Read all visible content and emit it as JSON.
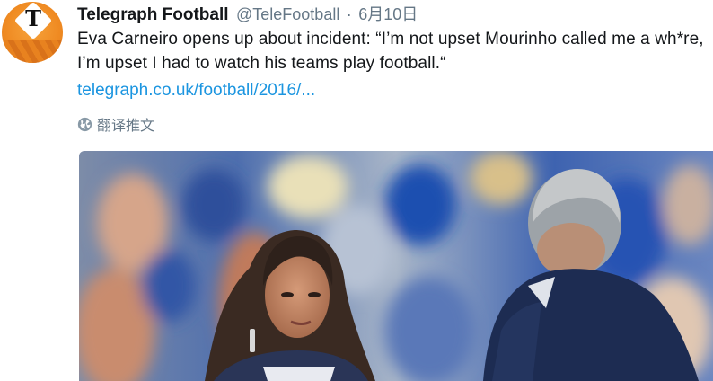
{
  "tweet": {
    "author_name": "Telegraph Football",
    "handle": "@TeleFootball",
    "separator": "·",
    "date": "6月10日",
    "text": "Eva Carneiro opens up about incident: “I’m not upset Mourinho called me a wh*re, I’m upset I had to watch his teams play football.“",
    "link": "telegraph.co.uk/football/2016/...",
    "translate_label": "翻译推文",
    "avatar_letter": "T"
  },
  "icons": {
    "avatar": "telegraph-logo",
    "translate": "globe-icon"
  },
  "colors": {
    "link": "#1b95e0",
    "muted": "#657786",
    "text": "#14171a",
    "avatar_orange": "#ef8a22"
  }
}
